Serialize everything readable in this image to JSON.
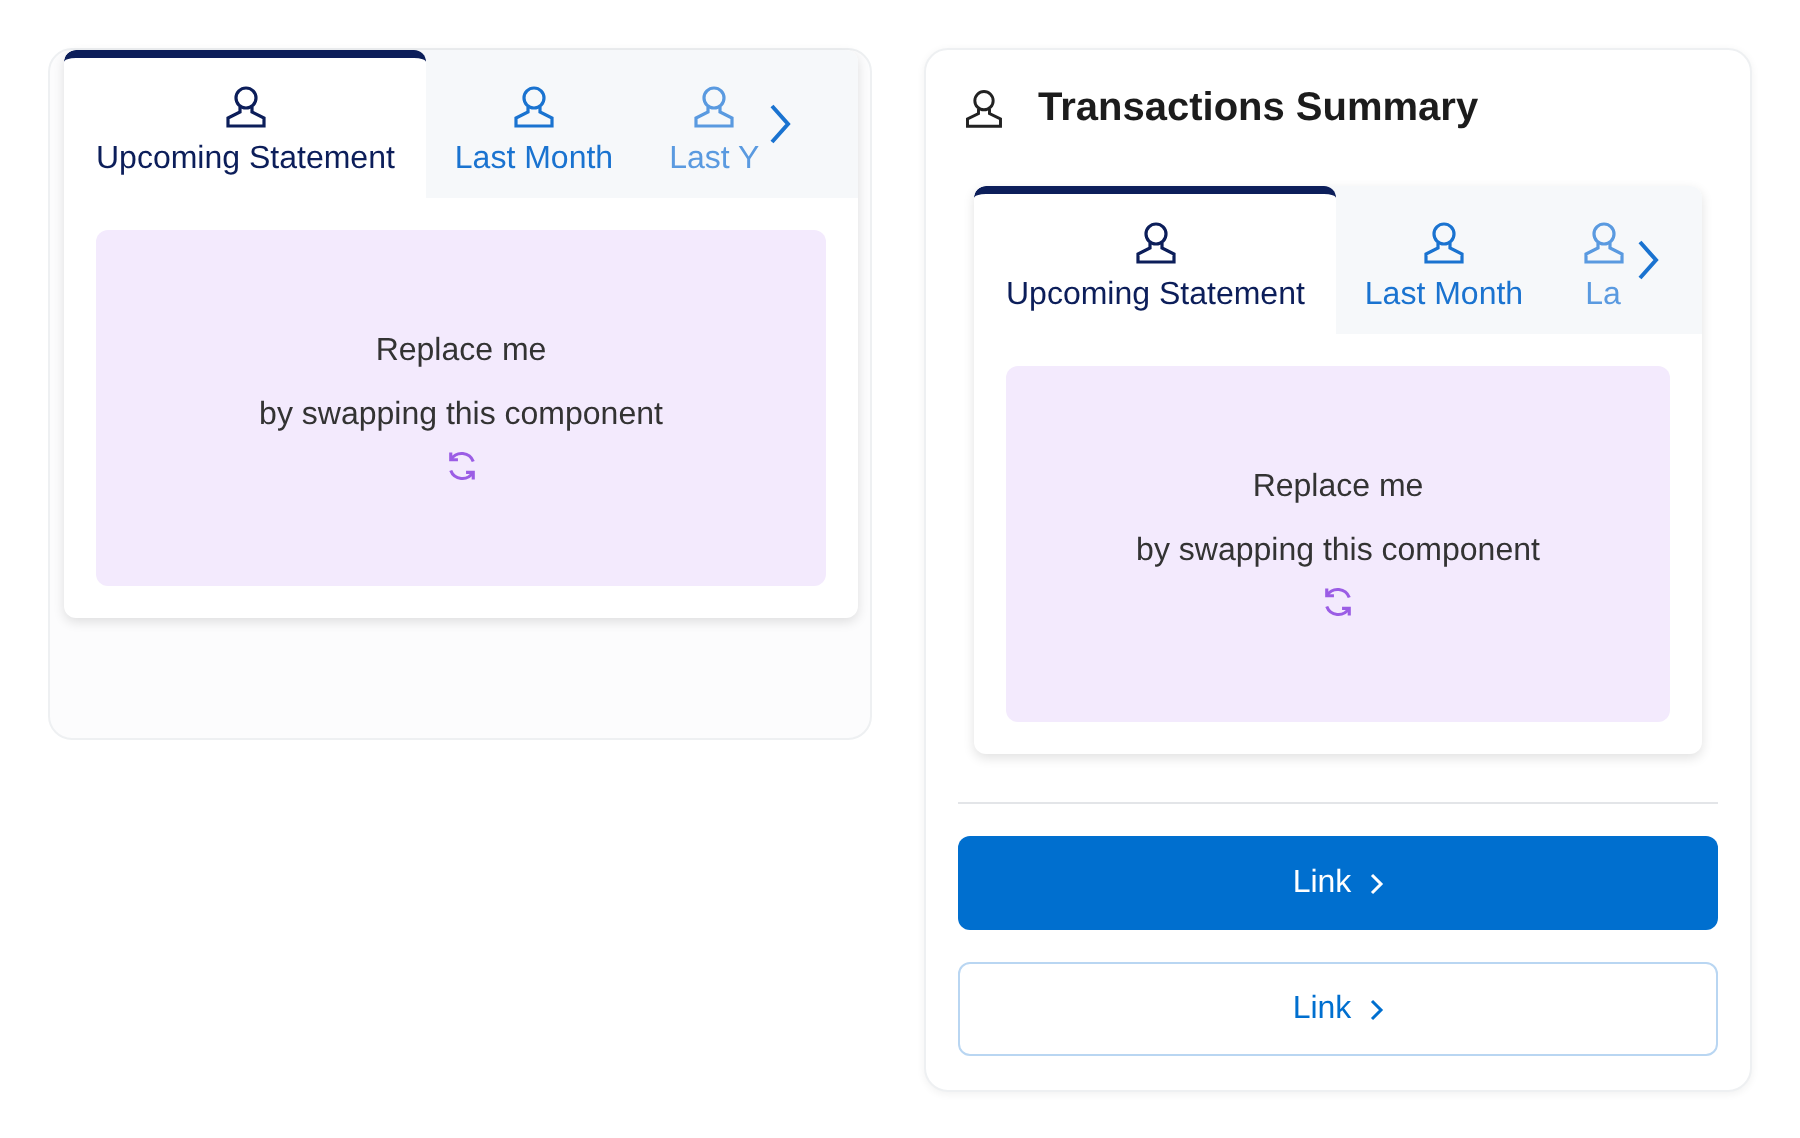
{
  "panels": [
    {
      "kind": "plain",
      "tabs": [
        {
          "label": "Upcoming Statement",
          "selected": true,
          "cut": false
        },
        {
          "label": "Last Month",
          "selected": false,
          "cut": false
        },
        {
          "label": "Last Y",
          "selected": false,
          "cut": true
        }
      ],
      "placeholder": {
        "line_1": "Replace me",
        "line_2": "by swapping this component"
      }
    },
    {
      "kind": "summary",
      "title": "Transactions Summary",
      "tabs": [
        {
          "label": "Upcoming Statement",
          "selected": true,
          "cut": false
        },
        {
          "label": "Last Month",
          "selected": false,
          "cut": false
        },
        {
          "label": "La",
          "selected": false,
          "cut": true
        }
      ],
      "placeholder": {
        "line_1": "Replace me",
        "line_2": "by swapping this component"
      },
      "buttons": [
        {
          "label": "Link",
          "kind": "primary"
        },
        {
          "label": "Link",
          "kind": "secondary"
        }
      ]
    }
  ]
}
